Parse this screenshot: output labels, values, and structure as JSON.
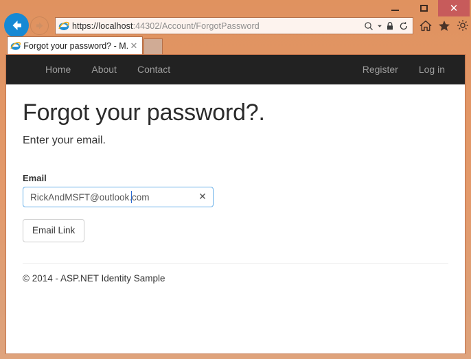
{
  "browser": {
    "window_controls": {
      "minimize": "−",
      "maximize": "□",
      "close": "✕"
    },
    "back_icon": "back-arrow-icon",
    "forward_icon": "forward-arrow-icon",
    "address": {
      "scheme_host": "https://localhost",
      "path": ":44302/Account/ForgotPassword",
      "full_url": "https://localhost:44302/Account/ForgotPassword",
      "search_icon": "search-icon",
      "dropdown_icon": "chevron-down-icon",
      "lock_icon": "lock-icon",
      "refresh_icon": "refresh-icon"
    },
    "command_icons": {
      "home": "home-icon",
      "favorites": "star-icon",
      "tools": "gear-icon"
    },
    "tab": {
      "title": "Forgot your password? - M...",
      "close_label": "✕",
      "favicon": "internet-explorer-icon"
    }
  },
  "page": {
    "navbar": {
      "left_links": [
        {
          "label": "Home"
        },
        {
          "label": "About"
        },
        {
          "label": "Contact"
        }
      ],
      "right_links": [
        {
          "label": "Register"
        },
        {
          "label": "Log in"
        }
      ]
    },
    "title": "Forgot your password?.",
    "subtitle": "Enter your email.",
    "form": {
      "email_label": "Email",
      "email_value": "RickAndMSFT@outlook.com",
      "email_placeholder": "",
      "clear_icon": "✕",
      "submit_label": "Email Link"
    },
    "footer": "© 2014 - ASP.NET Identity Sample"
  },
  "colors": {
    "window_chrome": "#e09568",
    "navbar_bg": "#222222",
    "nav_link": "#9d9d9d",
    "input_focus_border": "#66afe9",
    "close_button": "#c75b5b",
    "back_button": "#1689d4"
  }
}
